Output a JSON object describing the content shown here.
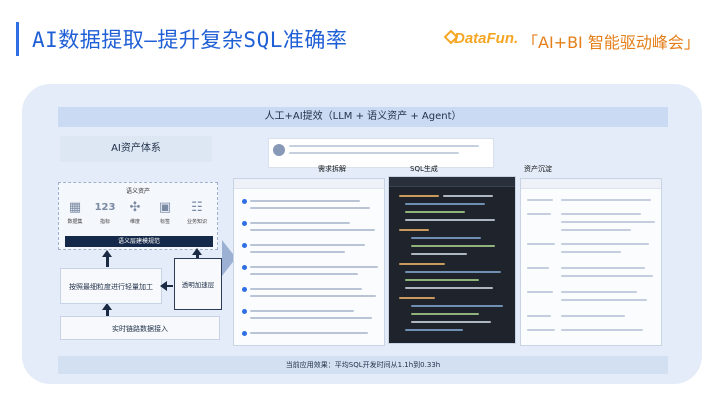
{
  "slide": {
    "title": "AI数据提取—提升复杂SQL准确率",
    "brand": "DataFun.",
    "event": "「AI+BI 智能驱动峰会」"
  },
  "banner": "人工+AI提效（LLM + 语义资产 + Agent）",
  "left": {
    "heading": "AI资产体系",
    "panel_title": "语义资产",
    "icons": [
      {
        "label": "数据集",
        "icon": "table-icon"
      },
      {
        "label": "指标",
        "icon": "metric-123-icon"
      },
      {
        "label": "维度",
        "icon": "dimension-icon"
      },
      {
        "label": "标签",
        "icon": "tag-icon"
      },
      {
        "label": "业务知识",
        "icon": "knowledge-icon"
      }
    ],
    "semantic_modeling": "语义层建模规范",
    "fine_tune": "按照最细粒度进行轻量加工",
    "transparent_layer": "透明加速层",
    "realtime_ingest": "实时链路数据接入"
  },
  "columns": {
    "req_split": "需求拆解",
    "sql_gen": "SQL生成",
    "asset_deposit": "资产沉淀"
  },
  "footer": "当前应用效果：平均SQL开发时间从1.1h到0.33h",
  "colors": {
    "title_blue": "#1f5fd6",
    "brand_orange": "#f5a623",
    "frame_bg": "#e3ecf8",
    "dark_navy": "#152a4a"
  }
}
